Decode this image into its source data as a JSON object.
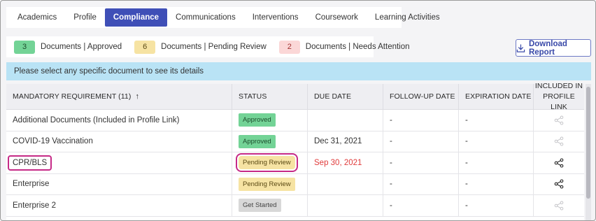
{
  "tabs": [
    {
      "label": "Academics"
    },
    {
      "label": "Profile"
    },
    {
      "label": "Compliance"
    },
    {
      "label": "Communications"
    },
    {
      "label": "Interventions"
    },
    {
      "label": "Coursework"
    },
    {
      "label": "Learning Activities"
    }
  ],
  "active_tab": "Compliance",
  "summary": {
    "approved": {
      "count": "3",
      "label": "Documents | Approved"
    },
    "pending": {
      "count": "6",
      "label": "Documents | Pending Review"
    },
    "attention": {
      "count": "2",
      "label": "Documents | Needs Attention"
    }
  },
  "download_label": "Download Report",
  "info_message": "Please select any specific document to see its details",
  "table": {
    "headers": {
      "requirement": "MANDATORY REQUIREMENT (11)",
      "sort_arrow": "↑",
      "status": "STATUS",
      "due_date": "DUE DATE",
      "follow_up": "FOLLOW-UP DATE",
      "expiration": "EXPIRATION DATE",
      "included_line1": "INCLUDED IN",
      "included_line2": "PROFILE LINK"
    },
    "rows": [
      {
        "name": "Additional Documents (Included in Profile Link)",
        "status": "Approved",
        "due": "",
        "follow_up": "-",
        "expiration": "-"
      },
      {
        "name": "COVID-19 Vaccination",
        "status": "Approved",
        "due": "Dec 31, 2021",
        "follow_up": "-",
        "expiration": "-"
      },
      {
        "name": "CPR/BLS",
        "status": "Pending Review",
        "due": "Sep 30, 2021",
        "follow_up": "-",
        "expiration": "-"
      },
      {
        "name": "Enterprise",
        "status": "Pending Review",
        "due": "",
        "follow_up": "-",
        "expiration": "-"
      },
      {
        "name": "Enterprise 2",
        "status": "Get Started",
        "due": "",
        "follow_up": "-",
        "expiration": "-"
      }
    ]
  },
  "colors": {
    "active_tab": "#3f4fb7",
    "approved": "#73d396",
    "pending": "#f6e3a3",
    "attention": "#fbd7d7",
    "info_bar": "#b9e3f5",
    "highlight": "#c62a87",
    "overdue": "#e03b3b"
  },
  "icons": {
    "download": "download-icon",
    "share": "share-icon"
  }
}
